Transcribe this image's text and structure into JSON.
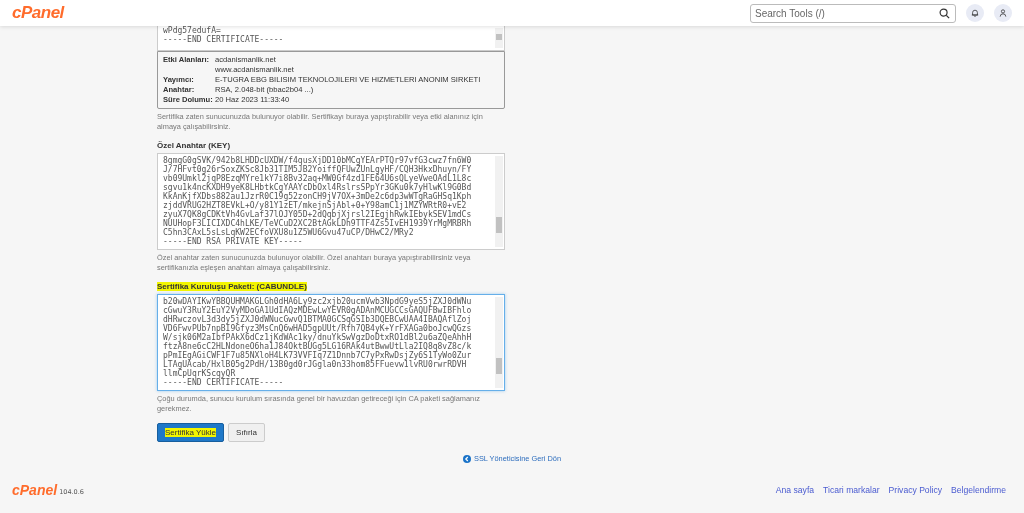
{
  "header": {
    "logo": "cPanel",
    "search": {
      "placeholder": "Search Tools (/)"
    }
  },
  "certificate": {
    "lines": [
      "wPdg57edufA=",
      "-----END CERTIFICATE-----"
    ]
  },
  "certificate_info": [
    {
      "label": "Etki Alanları:",
      "values": [
        "acdanismanlik.net",
        "www.acdanismanlik.net"
      ]
    },
    {
      "label": "Yayımcı:",
      "values": [
        "E-TUGRA EBG BILISIM TEKNOLOJILERI VE HIZMETLERI ANONIM SIRKETI"
      ]
    },
    {
      "label": "Anahtar:",
      "values": [
        "RSA, 2.048-bit (bbac2b04 ...)"
      ]
    },
    {
      "label": "Süre Dolumu:",
      "values": [
        "20 Haz 2023 11:33:40"
      ]
    }
  ],
  "certificate_help": "Sertifika zaten sunucunuzda bulunuyor olabilir. Sertifikayı buraya yapıştırabilir veya etki alanınız için almaya çalışabilirsiniz.",
  "private_key": {
    "label": "Özel Anahtar (KEY)",
    "highlighted": false,
    "lines": [
      "8gmgG0gSVK/942b8LHDDcUXDW/f4qusXjDD10bMCgYEArPTQr97vfG3cwz7fn6W0",
      "J/7HFvt0g26rSoxZKSc8Jb31TIM5JB2YoiffQFUwZUnLgyHF/CQH3HkxDhuyn/FY",
      "vb09Umkl2jqP8EzqMYre1kY7i8Bv32aq+MW0Gf4zd1FE64U6sQLyeVweOAdL1L8c",
      "sgvu1k4ncKXDH9yeK8LHbtkCgYAAYcDbOxl4RslrsSPpYr3GKu0k7yHlwKl9G0Bd",
      "KkAnKjfXDbs882au1JzrR0C19g52zonCH9jV7OX+3mDe2c6dp3wWTgRaGHSq1Kph",
      "zjddVRUG2HZT8EVkL+O/y81Y1zET/mkejnSjAbl+0+Y98amC1j1MZYWRtR0+vE2",
      "zyuX7QK8gCDKtVh4GvLaf37lOJY05D+2dQqbjXjrsl2IEgjhRwkIEbykSEV1mdCs",
      "NUUHopF3LICIXDC4hLKE/TeVCuD2XC2BtAGkLDh9TTF4Zs5IvEH1939YrMgMRBRh",
      "C5hn3CAxL5sLsLqKW2ECfoVXU8u1Z5WU6Gvu47uCP/DHwC2/MRy2",
      "-----END RSA PRIVATE KEY-----"
    ],
    "help": "Özel anahtar zaten sunucunuzda bulunuyor olabilir. Özel anahtarı buraya yapıştırabilirsiniz veya sertifikanızla eşleşen anahtarı almaya çalışabilirsiniz."
  },
  "ca_bundle": {
    "label": "Sertifika Kuruluşu Paketi: (CABUNDLE)",
    "highlighted": true,
    "lines": [
      "b20wDAYIKwYBBQUHMAKGLGh0dHA6Ly9zc2xjb20ucmVwb3NpdG9yeS5jZXJ0dWNu",
      "cGwuY3RuY2EuY2VyMDoGA1UdIAQzMDEwLwYEVR0gADAnMCUGCCsGAQUFBwIBFhlo",
      "dHRwczovL3d3dy5jZXJ0dWNucGwvQ1BTMA0GCSqGSIb3DQEBCwUAA4IBAQAflZoj",
      "VD6FwvPUb7npBI9Gfyz3MsCnQ6wHAD5gpUUt/Rfh7QB4yK+YrFXAGa0boJcwQGzs",
      "W/sjk06M2aIbfPAkX6dCz1jKdWAc1ky/dnuYkSwVgzDoDtxRO1dBl2u6aZQeAhhH",
      "ftzA8ne6cC2HLNdoneO6ha1J84OktBUGg5LG16RAk4utBwwUtLla2IQ8q8vZ8c/k",
      "pPmIEgAGiCWF1F7u85NXloH4LK73VVFIq7Z1Dnnb7C7yPxRwDsjZy6S1TyWo0Zur",
      "LTAgUAcab/HxlB05g2PdH/13B0gd0rJGgla0n33hom85FFuevw1lvRU0rwrRDVH",
      "llmCpUqrKScqyQR",
      "-----END CERTIFICATE-----"
    ],
    "help": "Çoğu durumda, sunucu kurulum sırasında genel bir havuzdan getireceği için CA paketi sağlamanız gerekmez."
  },
  "buttons": [
    {
      "label": "Sertifika Yükle",
      "kind": "primary",
      "highlighted": true
    },
    {
      "label": "Sıfırla",
      "kind": "secondary",
      "highlighted": false
    }
  ],
  "back_link": "SSL Yöneticisine Geri Dön",
  "footer": {
    "logo": "cPanel",
    "version": "104.0.6",
    "links": [
      "Ana sayfa",
      "Ticari markalar",
      "Privacy Policy",
      "Belgelendirme"
    ]
  }
}
